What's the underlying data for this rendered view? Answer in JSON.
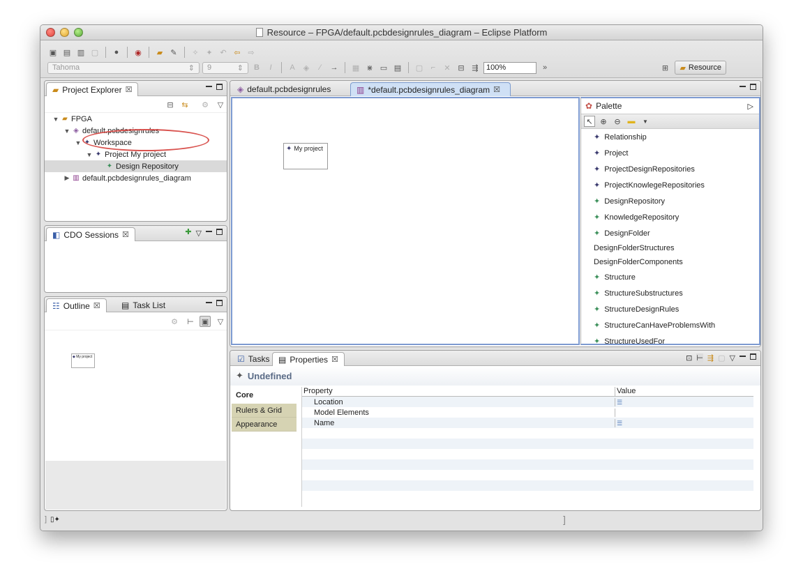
{
  "window": {
    "title": "Resource – FPGA/default.pcbdesignrules_diagram – Eclipse Platform"
  },
  "toolbar": {
    "font_name": "Tahoma",
    "font_size": "9",
    "zoom": "100%",
    "overflow": "»",
    "perspective_label": "Resource"
  },
  "project_explorer": {
    "tab_label": "Project Explorer",
    "tree": [
      {
        "label": "FPGA",
        "level": 0,
        "icon": "folder-icon",
        "twisty": "▼"
      },
      {
        "label": "default.pcbdesignrules",
        "level": 1,
        "icon": "model-file-icon",
        "twisty": "▼"
      },
      {
        "label": "Workspace",
        "level": 2,
        "icon": "diamond-icon",
        "twisty": "▼"
      },
      {
        "label": "Project My project",
        "level": 3,
        "icon": "diamond-icon",
        "twisty": "▼"
      },
      {
        "label": "Design Repository",
        "level": 4,
        "icon": "green-diamond-icon",
        "twisty": ""
      },
      {
        "label": "default.pcbdesignrules_diagram",
        "level": 1,
        "icon": "diagram-file-icon",
        "twisty": "▶"
      }
    ]
  },
  "cdo_sessions": {
    "tab_label": "CDO Sessions"
  },
  "outline": {
    "tab_label": "Outline",
    "task_list_label": "Task List",
    "thumb_label": "My project"
  },
  "editor": {
    "tabs": [
      {
        "label": "default.pcbdesignrules",
        "active": false
      },
      {
        "label": "*default.pcbdesignrules_diagram",
        "active": true
      }
    ],
    "node_label": "My project"
  },
  "palette": {
    "title": "Palette",
    "items": [
      {
        "label": "Relationship",
        "icon": "diamond-icon"
      },
      {
        "label": "Project",
        "icon": "diamond-icon"
      },
      {
        "label": "ProjectDesignRepositories",
        "icon": "diamond-icon"
      },
      {
        "label": "ProjectKnowlegeRepositories",
        "icon": "diamond-icon"
      },
      {
        "label": "DesignRepository",
        "icon": "green-diamond-icon"
      },
      {
        "label": "KnowledgeRepository",
        "icon": "green-diamond-icon"
      },
      {
        "label": "DesignFolder",
        "icon": "green-diamond-icon"
      },
      {
        "label": "DesignFolderStructures",
        "icon": ""
      },
      {
        "label": "DesignFolderComponents",
        "icon": ""
      },
      {
        "label": "Structure",
        "icon": "green-diamond-icon"
      },
      {
        "label": "StructureSubstructures",
        "icon": "green-diamond-icon"
      },
      {
        "label": "StructureDesignRules",
        "icon": "green-diamond-icon"
      },
      {
        "label": "StructureCanHaveProblemsWith",
        "icon": "green-diamond-icon"
      },
      {
        "label": "StructureUsedFor",
        "icon": "green-diamond-icon"
      }
    ]
  },
  "bottom": {
    "tasks_label": "Tasks",
    "properties_label": "Properties",
    "heading": "Undefined",
    "side_tabs": [
      "Core",
      "Rulers & Grid",
      "Appearance"
    ],
    "columns": [
      "Property",
      "Value"
    ],
    "rows": [
      {
        "property": "Location",
        "has_value_icon": true
      },
      {
        "property": "Model Elements",
        "has_value_icon": false
      },
      {
        "property": "Name",
        "has_value_icon": true
      }
    ]
  },
  "colors": {
    "editor_border": "#7d9ad0",
    "selection": "#d9d9d9",
    "highlight_ellipse": "#d9534f",
    "properties_heading": "#5a6b86"
  }
}
